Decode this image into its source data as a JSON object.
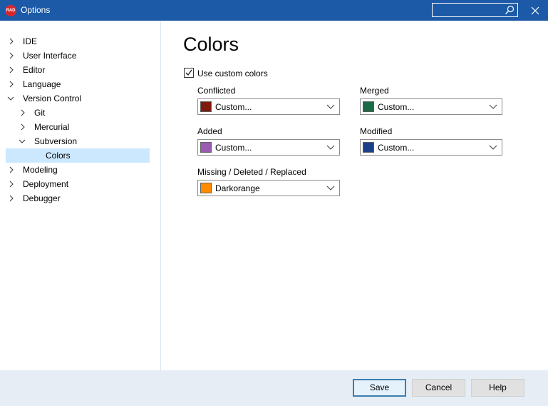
{
  "window": {
    "badge": "RAD",
    "title": "Options",
    "search_placeholder": ""
  },
  "tree": {
    "items": [
      {
        "label": "IDE",
        "expanded": false
      },
      {
        "label": "User Interface",
        "expanded": false
      },
      {
        "label": "Editor",
        "expanded": false
      },
      {
        "label": "Language",
        "expanded": false
      },
      {
        "label": "Version Control",
        "expanded": true
      },
      {
        "label": "Git",
        "expanded": false
      },
      {
        "label": "Mercurial",
        "expanded": false
      },
      {
        "label": "Subversion",
        "expanded": true
      },
      {
        "label": "Colors",
        "selected": true
      },
      {
        "label": "Modeling",
        "expanded": false
      },
      {
        "label": "Deployment",
        "expanded": false
      },
      {
        "label": "Debugger",
        "expanded": false
      }
    ]
  },
  "content": {
    "title": "Colors",
    "use_custom_colors": {
      "label": "Use custom colors",
      "checked": true
    },
    "fields": {
      "conflicted": {
        "label": "Conflicted",
        "value": "Custom...",
        "color": "#7f1a0d"
      },
      "merged": {
        "label": "Merged",
        "value": "Custom...",
        "color": "#1a6b45"
      },
      "added": {
        "label": "Added",
        "value": "Custom...",
        "color": "#9a5bb0"
      },
      "modified": {
        "label": "Modified",
        "value": "Custom...",
        "color": "#1c3f8a"
      },
      "missing": {
        "label": "Missing / Deleted / Replaced",
        "value": "Darkorange",
        "color": "#ff8c00"
      }
    }
  },
  "footer": {
    "save": "Save",
    "cancel": "Cancel",
    "help": "Help"
  },
  "colors": {
    "titlebar": "#1c5aa8",
    "selection": "#cce8ff",
    "footer": "#e6edf4",
    "accent": "#3c7fb1"
  }
}
